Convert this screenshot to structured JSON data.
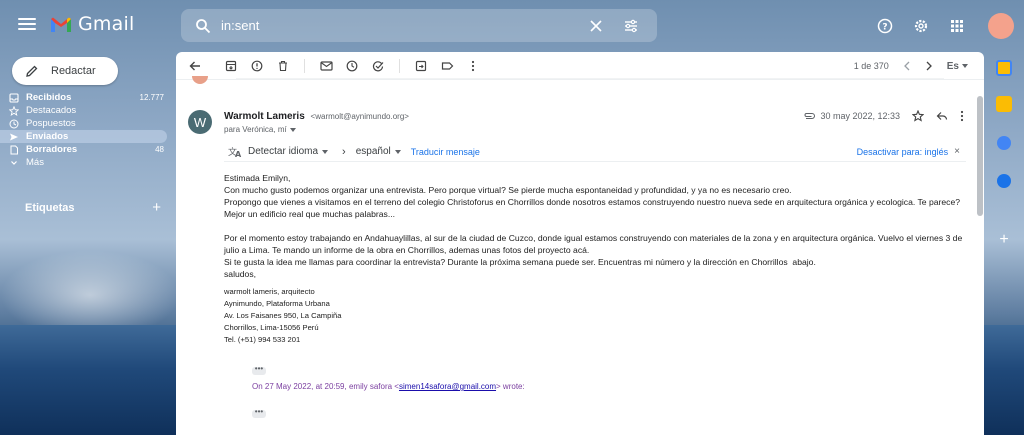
{
  "app": {
    "name": "Gmail"
  },
  "search": {
    "value": "in:sent"
  },
  "compose": {
    "label": "Redactar"
  },
  "nav": {
    "items": [
      {
        "label": "Recibidos",
        "count": "12.777",
        "bold": true,
        "icon": "inbox-icon"
      },
      {
        "label": "Destacados",
        "count": "",
        "bold": false,
        "icon": "star-icon"
      },
      {
        "label": "Pospuestos",
        "count": "",
        "bold": false,
        "icon": "clock-icon"
      },
      {
        "label": "Enviados",
        "count": "",
        "bold": false,
        "icon": "send-icon",
        "active": true
      },
      {
        "label": "Borradores",
        "count": "48",
        "bold": true,
        "icon": "draft-icon"
      },
      {
        "label": "Más",
        "count": "",
        "bold": false,
        "icon": "chevron-down-icon"
      }
    ]
  },
  "labels": {
    "title": "Etiquetas",
    "add": "+"
  },
  "toolbar": {
    "pagination": "1 de 370",
    "lang": "Es"
  },
  "message": {
    "avatar_letter": "W",
    "sender_name": "Warmolt Lameris",
    "sender_email": "<warmolt@aynimundo.org>",
    "to": "para Verónica, mí",
    "date": "30 may 2022, 12:33"
  },
  "translate": {
    "detect": "Detectar idioma",
    "arrow": "›",
    "target": "español",
    "link": "Traducir mensaje",
    "disable": "Desactivar para: inglés",
    "close": "×"
  },
  "body": {
    "greeting": "Estimada Emilyn,",
    "p1": "Con mucho gusto podemos organizar una entrevista. Pero porque virtual? Se pierde mucha espontaneidad y profundidad, y ya no es necesario creo.",
    "p2": "Propongo que vienes a visitamos en el terreno del colegio Christoforus en Chorrillos donde nosotros estamos construyendo nuestro nueva sede en arquitectura orgánica y ecologica. Te parece?",
    "p3": "Mejor un edificio real que muchas palabras...",
    "p4": "Por el momento estoy trabajando en Andahuaylillas, al sur de la ciudad de Cuzco, donde igual estamos construyendo con materiales de la zona y en arquitectura orgánica. Vuelvo el viernes 3 de",
    "p5": "julio a Lima. Te mando un informe de la obra en Chorrillos, ademas unas fotos del proyecto acá.",
    "p6": "Si te gusta la idea me llamas para coordinar la entrevista? Durante la próxima semana puede ser. Encuentras mi número y la dirección en Chorrillos  abajo.",
    "p7": "saludos,",
    "sig1": "warmolt lameris, arquitecto",
    "sig2": "Aynimundo, Plataforma Urbana",
    "sig3": "Av. Los Faisanes 950, La Campiña",
    "sig4": "Chorrillos, Lima-15056  Perú",
    "sig5": "Tel. (+51)  994 533 201",
    "ellipsis": "•••",
    "quote_prefix": "On 27 May 2022, at 20:59, emily safora <",
    "quote_email": "simen14safora@gmail.com",
    "quote_suffix": "> wrote:"
  },
  "colors": {
    "accent_red": "#ea4335",
    "link_blue": "#1a73e8",
    "quote_purple": "#7b3fa0"
  }
}
